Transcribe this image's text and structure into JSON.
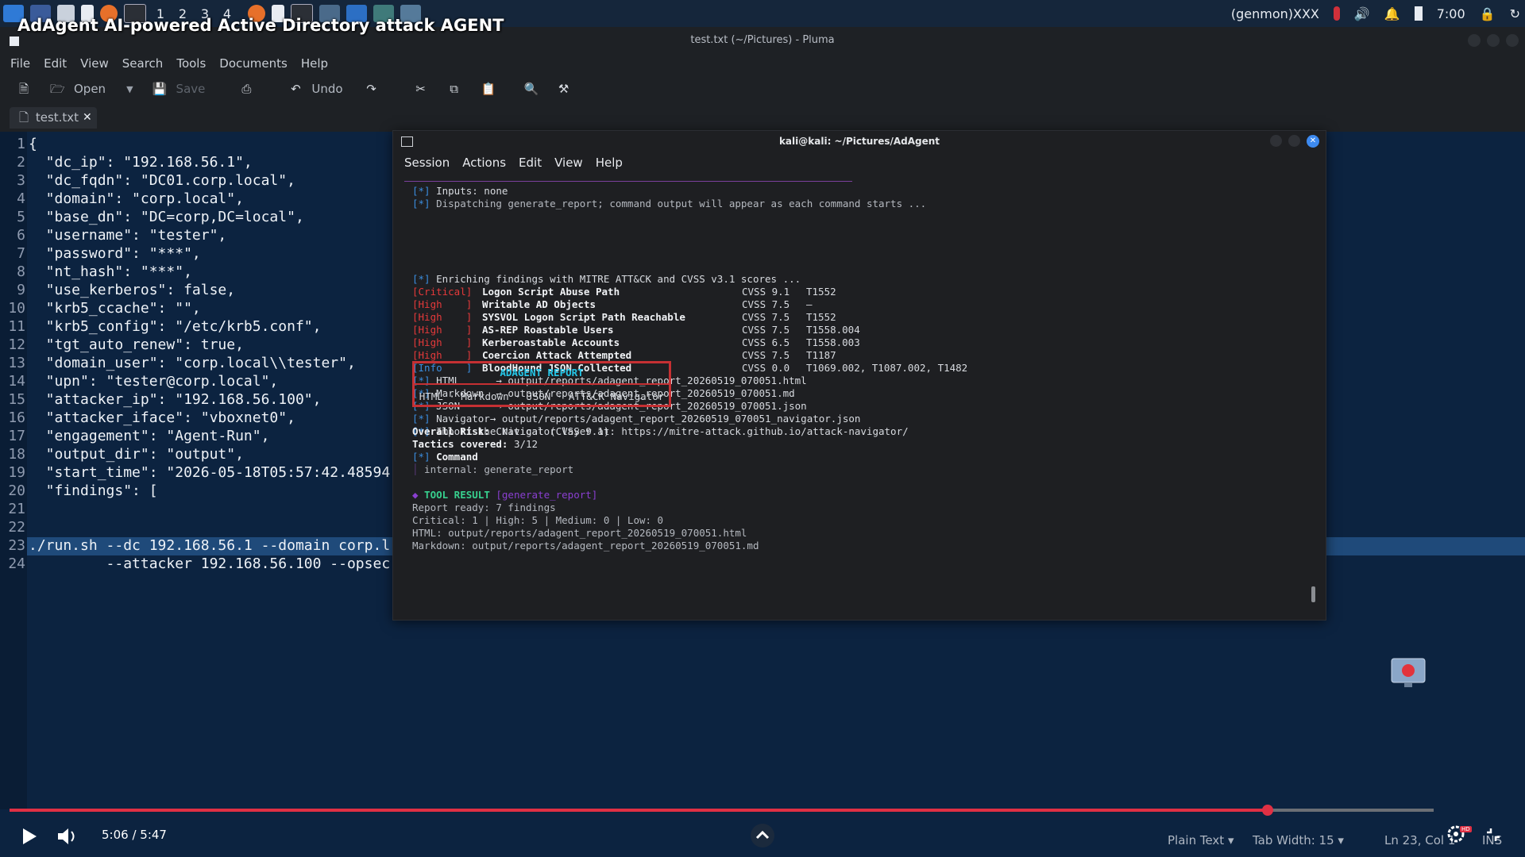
{
  "video": {
    "title": "AdAgent AI-powered Active Directory attack AGENT",
    "time": "5:06 / 5:47",
    "progress_fraction": 0.8835
  },
  "panel": {
    "workspaces": [
      "1",
      "2",
      "3",
      "4"
    ],
    "genmon": "(genmon)XXX",
    "clock": "7:00"
  },
  "pluma": {
    "window_title": "test.txt (~/Pictures) - Pluma",
    "menu": [
      "File",
      "Edit",
      "View",
      "Search",
      "Tools",
      "Documents",
      "Help"
    ],
    "toolbar": {
      "open_label": "Open",
      "save_label": "Save",
      "undo_label": "Undo"
    },
    "tab_label": "test.txt",
    "lines": [
      {
        "n": "1",
        "text": "{"
      },
      {
        "n": "2",
        "text": "  \"dc_ip\": \"192.168.56.1\","
      },
      {
        "n": "3",
        "text": "  \"dc_fqdn\": \"DC01.corp.local\","
      },
      {
        "n": "4",
        "text": "  \"domain\": \"corp.local\","
      },
      {
        "n": "5",
        "text": "  \"base_dn\": \"DC=corp,DC=local\","
      },
      {
        "n": "6",
        "text": "  \"username\": \"tester\","
      },
      {
        "n": "7",
        "text": "  \"password\": \"***\","
      },
      {
        "n": "8",
        "text": "  \"nt_hash\": \"***\","
      },
      {
        "n": "9",
        "text": "  \"use_kerberos\": false,"
      },
      {
        "n": "10",
        "text": "  \"krb5_ccache\": \"\","
      },
      {
        "n": "11",
        "text": "  \"krb5_config\": \"/etc/krb5.conf\","
      },
      {
        "n": "12",
        "text": "  \"tgt_auto_renew\": true,"
      },
      {
        "n": "13",
        "text": "  \"domain_user\": \"corp.local\\\\tester\","
      },
      {
        "n": "14",
        "text": "  \"upn\": \"tester@corp.local\","
      },
      {
        "n": "15",
        "text": "  \"attacker_ip\": \"192.168.56.100\","
      },
      {
        "n": "16",
        "text": "  \"attacker_iface\": \"vboxnet0\","
      },
      {
        "n": "17",
        "text": "  \"engagement\": \"Agent-Run\","
      },
      {
        "n": "18",
        "text": "  \"output_dir\": \"output\","
      },
      {
        "n": "19",
        "text": "  \"start_time\": \"2026-05-18T05:57:42.48594"
      },
      {
        "n": "20",
        "text": "  \"findings\": ["
      },
      {
        "n": "21",
        "text": ""
      },
      {
        "n": "22",
        "text": ""
      },
      {
        "n": "23",
        "text": "./run.sh --dc 192.168.56.1 --domain corp.l"
      },
      {
        "n": "24",
        "text": "         --attacker 192.168.56.100 --opsec"
      }
    ],
    "status": {
      "language": "Plain Text",
      "tab_width": "Tab Width: 15",
      "position": "Ln 23, Col 1",
      "mode": "INS"
    }
  },
  "terminal": {
    "title": "kali@kali: ~/Pictures/AdAgent",
    "menu": [
      "Session",
      "Actions",
      "Edit",
      "View",
      "Help"
    ],
    "prefix": "[*]",
    "inputs_line": " Inputs: none",
    "dispatch_line": " Dispatching generate_report; command output will appear as each command starts ...",
    "report_title": "ADAGENT REPORT",
    "report_subtitle": "HTML · Markdown · JSON · ATT&CK Navigator",
    "enrich_line": " Enriching findings with MITRE ATT&CK and CVSS v3.1 scores ...",
    "findings": [
      {
        "sev": "[Critical]",
        "title": "Logon Script Abuse Path",
        "cvss": "CVSS 9.1",
        "tech": "T1552",
        "color": "#e5393a"
      },
      {
        "sev": "[High    ]",
        "title": "Writable AD Objects",
        "cvss": "CVSS 7.5",
        "tech": "—",
        "color": "#e5393a"
      },
      {
        "sev": "[High    ]",
        "title": "SYSVOL Logon Script Path Reachable",
        "cvss": "CVSS 7.5",
        "tech": "T1552",
        "color": "#e5393a"
      },
      {
        "sev": "[High    ]",
        "title": "AS-REP Roastable Users",
        "cvss": "CVSS 7.5",
        "tech": "T1558.004",
        "color": "#e5393a"
      },
      {
        "sev": "[High    ]",
        "title": "Kerberoastable Accounts",
        "cvss": "CVSS 6.5",
        "tech": "T1558.003",
        "color": "#e5393a"
      },
      {
        "sev": "[High    ]",
        "title": "Coercion Attack Attempted",
        "cvss": "CVSS 7.5",
        "tech": "T1187",
        "color": "#e5393a"
      },
      {
        "sev": "[Info    ]",
        "title": "BloodHound JSON Collected",
        "cvss": "CVSS 0.0",
        "tech": "T1069.002, T1087.002, T1482",
        "color": "#3b8ee0"
      }
    ],
    "outputs": [
      " HTML      → output/reports/adagent_report_20260519_070051.html",
      " Markdown  → output/reports/adagent_report_20260519_070051.md",
      " JSON      → output/reports/adagent_report_20260519_070051.json",
      " Navigator→ output/reports/adagent_report_20260519_070051_navigator.json",
      " Import the Navigator layer at: https://mitre-attack.github.io/attack-navigator/"
    ],
    "overall_risk_label": "Overall Risk:",
    "overall_risk_value": " Critical (CVSS 9.1)",
    "tactics_label": "Tactics covered:",
    "tactics_value": " 3/12",
    "command_label": " Command",
    "command_pipe": "│",
    "command_value": " internal: generate_report",
    "tool_result_marker": "◆",
    "tool_result_label": " TOOL RESULT ",
    "tool_result_name": "[generate_report]",
    "result_lines": [
      "Report ready: 7 findings",
      "Critical: 1 | High: 5 | Medium: 0 | Low: 0",
      "HTML: output/reports/adagent_report_20260519_070051.html",
      "Markdown: output/reports/adagent_report_20260519_070051.md"
    ]
  },
  "colors": {
    "accent_red": "#e03044",
    "editor_bg": "#0c2340",
    "terminal_bg": "#1e1f22",
    "severity_high": "#e5393a",
    "severity_info": "#3b8ee0"
  }
}
